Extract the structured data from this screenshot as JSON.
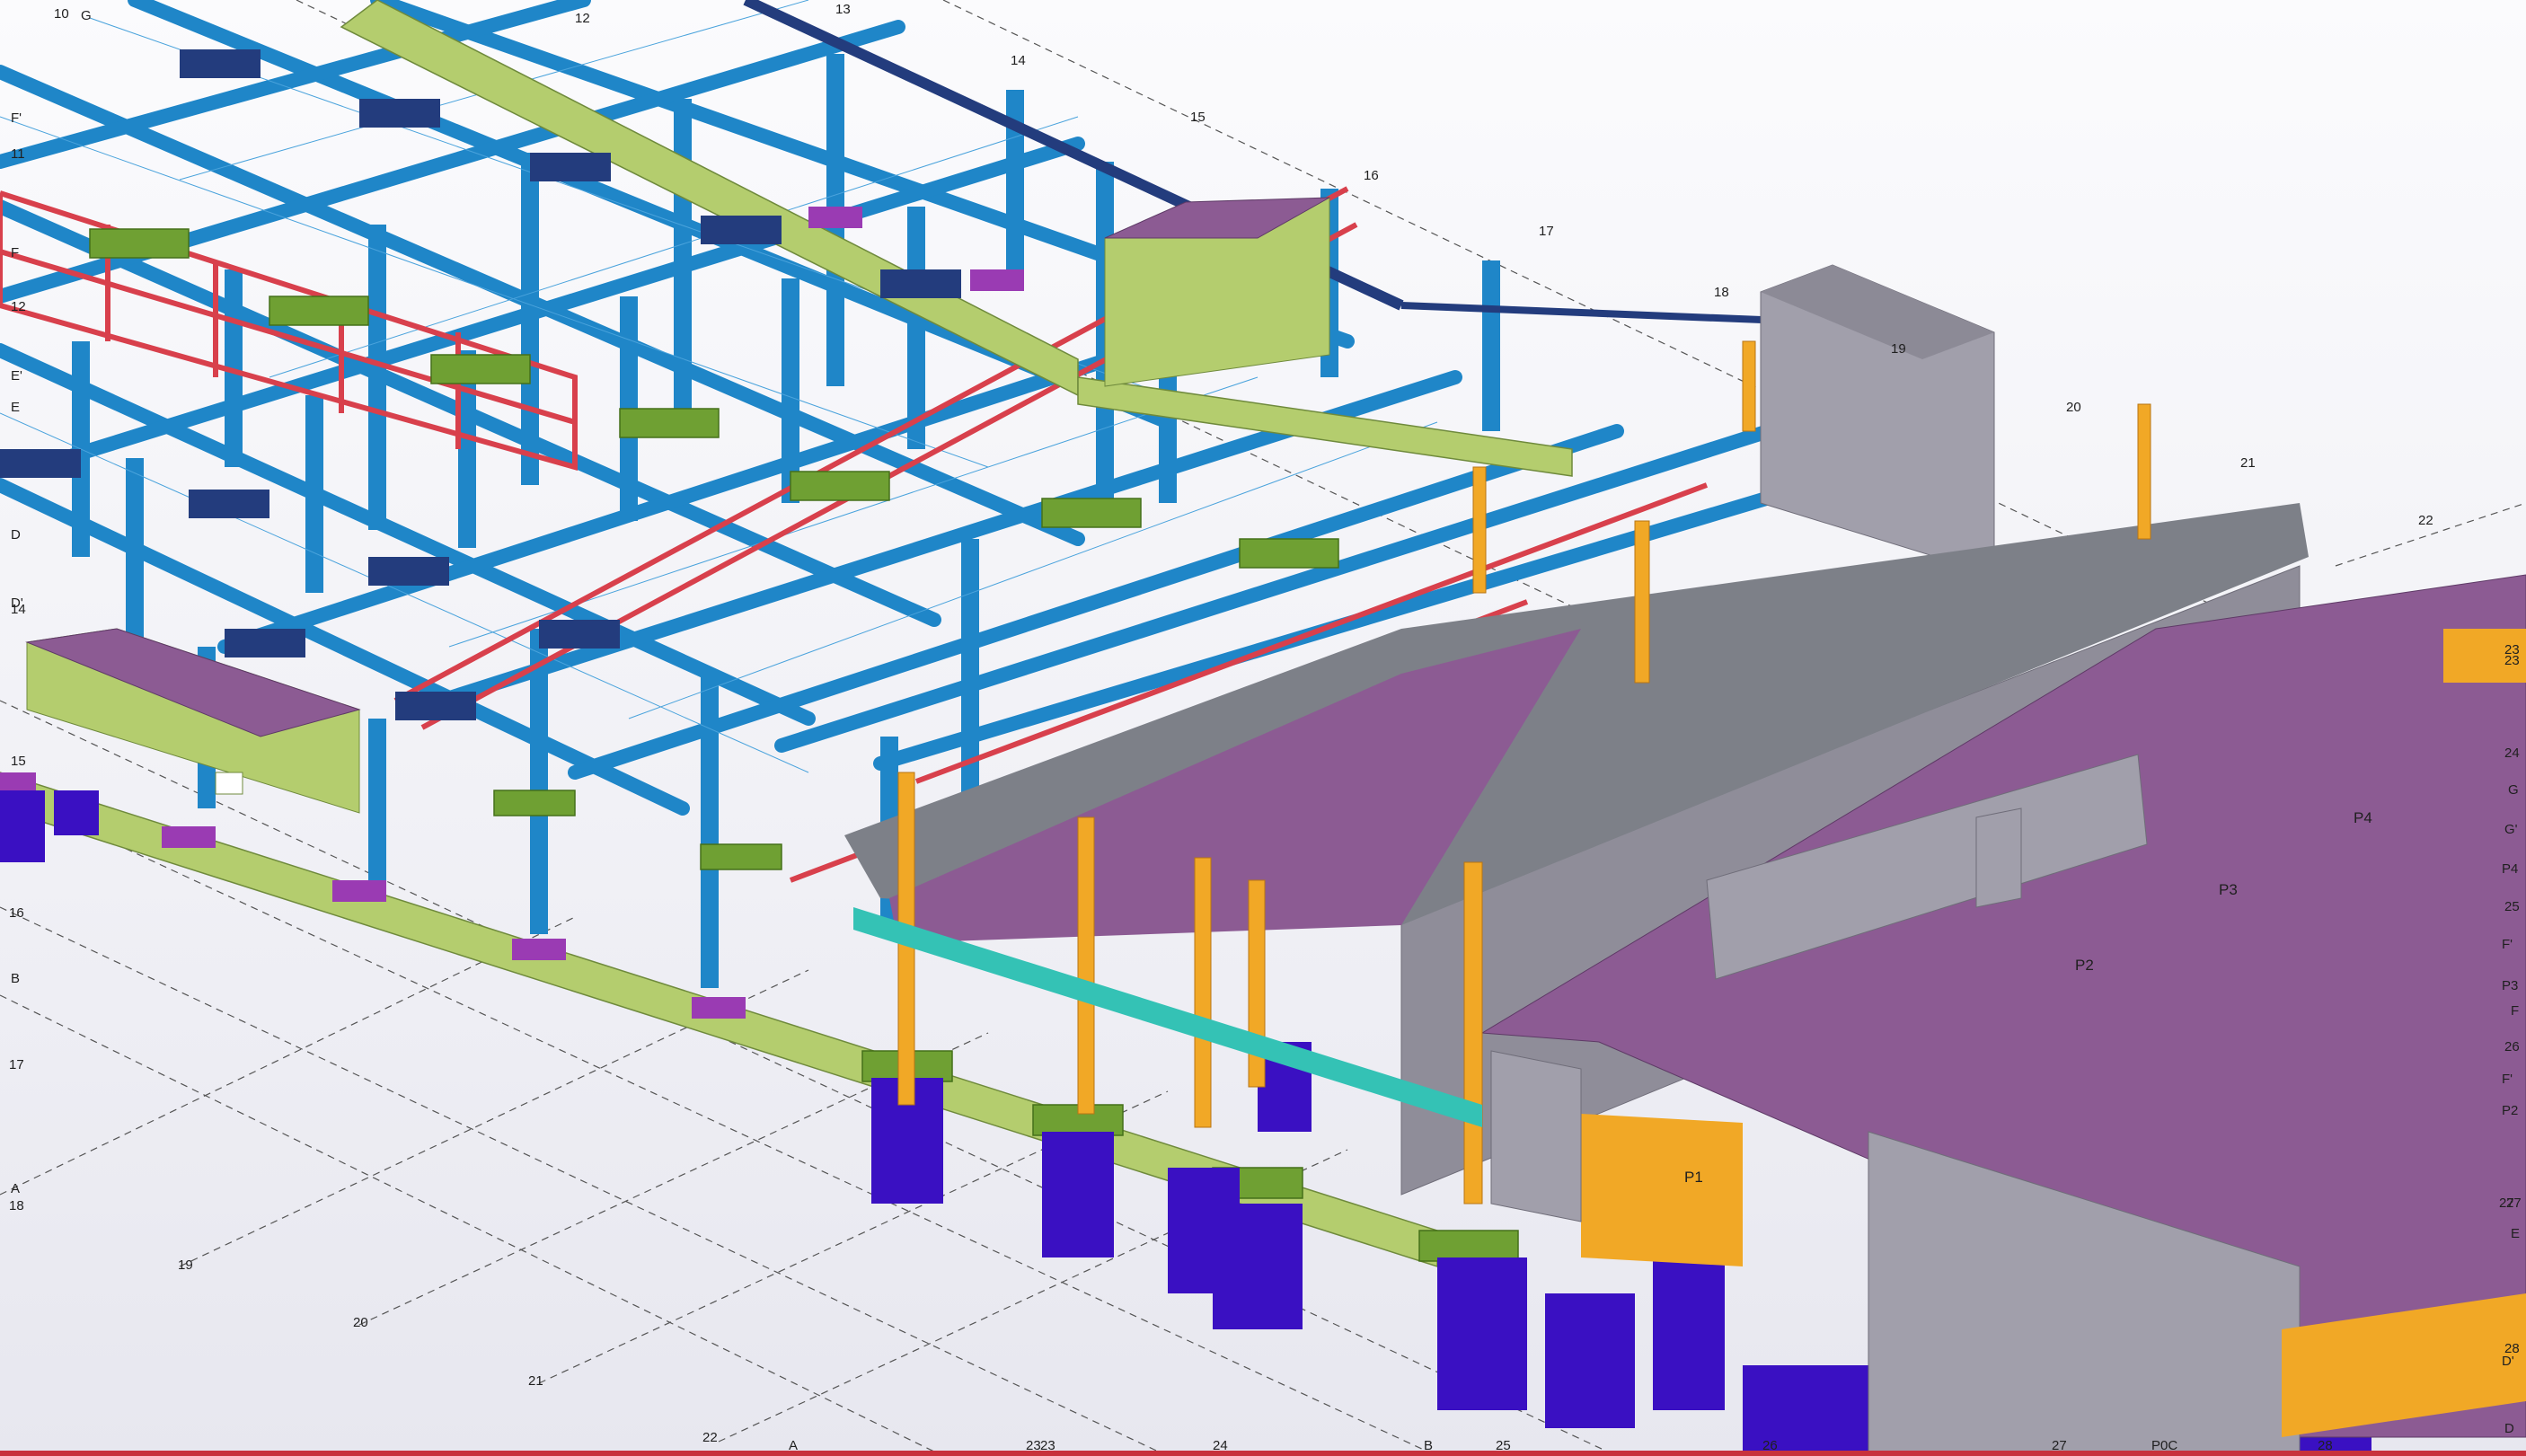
{
  "gridlines": {
    "numbers_top": [
      "10",
      "12",
      "13",
      "14",
      "15",
      "16",
      "17",
      "18",
      "19",
      "20",
      "21",
      "22"
    ],
    "numbers_bottom": [
      "16",
      "17",
      "18",
      "19",
      "20",
      "21",
      "22"
    ],
    "letters_left": [
      "G",
      "F'",
      "11",
      "F",
      "12",
      "E'",
      "E",
      "D",
      "D'",
      "14",
      "15",
      "B",
      "A"
    ],
    "bottom_axis": [
      "A",
      "23",
      "23",
      "24",
      "B",
      "25",
      "26",
      "27",
      "P0C",
      "28"
    ],
    "right_axis": [
      "23",
      "23",
      "24",
      "G",
      "G'",
      "P4",
      "25",
      "F'",
      "P3",
      "F",
      "26",
      "F'",
      "P2",
      "27",
      "27",
      "E",
      "28",
      "D'",
      "D"
    ]
  },
  "zones": [
    "P1",
    "P2",
    "P3",
    "P4"
  ],
  "colors": {
    "steel_blue": "#1f86c8",
    "truss_red": "#d8404c",
    "slab_purple": "#8c5b93",
    "footing_green": "#6fa033",
    "beam_lime": "#b4cd6e",
    "pile_indigo": "#3a10c2",
    "column_orange": "#f1a826",
    "wall_grey": "#a19fab",
    "base_navy": "#233c7d"
  }
}
